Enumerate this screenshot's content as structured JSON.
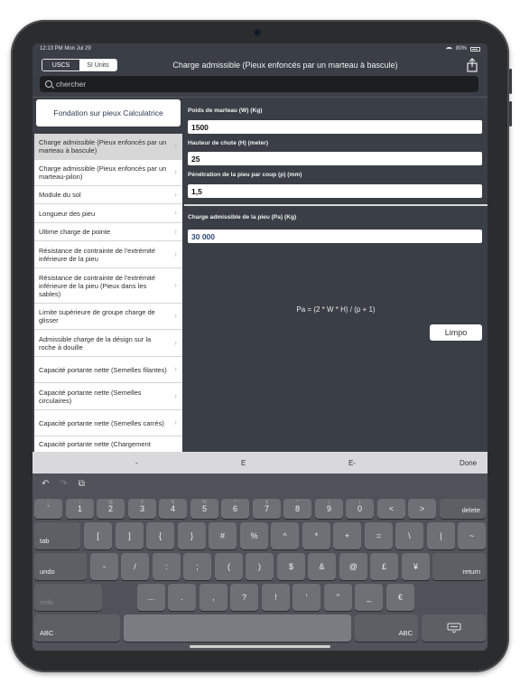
{
  "status": {
    "time": "12:13 PM  Mon Jul 29",
    "battery": "80%"
  },
  "nav": {
    "segments": [
      "USCS",
      "SI Units"
    ],
    "title": "Charge admissible (Pieux enfoncés par un marteau à bascule)",
    "share_icon": "share-icon"
  },
  "search": {
    "placeholder": "chercher"
  },
  "sidebar": {
    "calc_button": "Fondation sur pieux Calculatrice",
    "items": [
      {
        "label": "Charge admissible (Pieux enfoncés par un marteau à bascule)"
      },
      {
        "label": "Charge admissible (Pieux enfoncés par un marteau-pilon)"
      },
      {
        "label": "Module du sol"
      },
      {
        "label": "Longueur des pieu"
      },
      {
        "label": "Ultime charge de pointe"
      },
      {
        "label": "Résistance de contrainte de l'extrémité inférieure de la pieu"
      },
      {
        "label": "Résistance de contrainte de l'extrémité inférieure de la pieu (Pieux dans les sables)"
      },
      {
        "label": "Limite supérieure de groupe charge de glisser"
      },
      {
        "label": "Admissible charge de la désign sur la roche à douille"
      },
      {
        "label": "Capacité portante nette (Semelles filantes)"
      },
      {
        "label": "Capacité portante nette (Semelles circulaires)"
      },
      {
        "label": "Capacité portante nette (Semelles carrés)"
      },
      {
        "label": "Capacité portante nette (Chargement"
      }
    ]
  },
  "form": {
    "hammer_label": "Poids de marteau (W) (Kg)",
    "hammer_value": "1500",
    "height_label": "Hauteur de chute (H) (meter)",
    "height_value": "25",
    "penetration_label": "Pénétration de la pieu par coup (p) (mm)",
    "penetration_value": "1,5",
    "result_label": "Charge admissible de la pieu (Pa) (Kg)",
    "result_value": "30 000",
    "formula": "Pa = (2 * W * H) / (p + 1)",
    "clear_button": "Limpo"
  },
  "accessory": {
    "minus": "-",
    "e": "E",
    "e_minus": "E-",
    "done": "Done"
  },
  "keyboard": {
    "row1": [
      {
        "k": "`",
        "h": "~"
      },
      {
        "k": "1",
        "h": "!"
      },
      {
        "k": "2",
        "h": "@"
      },
      {
        "k": "3",
        "h": "#"
      },
      {
        "k": "4",
        "h": "$"
      },
      {
        "k": "5",
        "h": "%"
      },
      {
        "k": "6",
        "h": "^"
      },
      {
        "k": "7",
        "h": "&"
      },
      {
        "k": "8",
        "h": "*"
      },
      {
        "k": "9",
        "h": "("
      },
      {
        "k": "0",
        "h": ")"
      },
      {
        "k": "<",
        "h": ""
      },
      {
        "k": ">",
        "h": ""
      }
    ],
    "delete": "delete",
    "tab": "tab",
    "row2": [
      "[",
      "]",
      "{",
      "}",
      "#",
      "%",
      "^",
      "*",
      "+",
      "=",
      "\\",
      "|",
      "~"
    ],
    "undo": "undo",
    "row3": [
      "-",
      "/",
      ":",
      ";",
      "(",
      ")",
      "$",
      "&",
      "@",
      "£",
      "¥"
    ],
    "return": "return",
    "redo": "redo",
    "row4": [
      "...",
      ".",
      ",",
      "?",
      "!",
      "'",
      "\"",
      "_",
      "€"
    ],
    "abc": "ABC"
  }
}
